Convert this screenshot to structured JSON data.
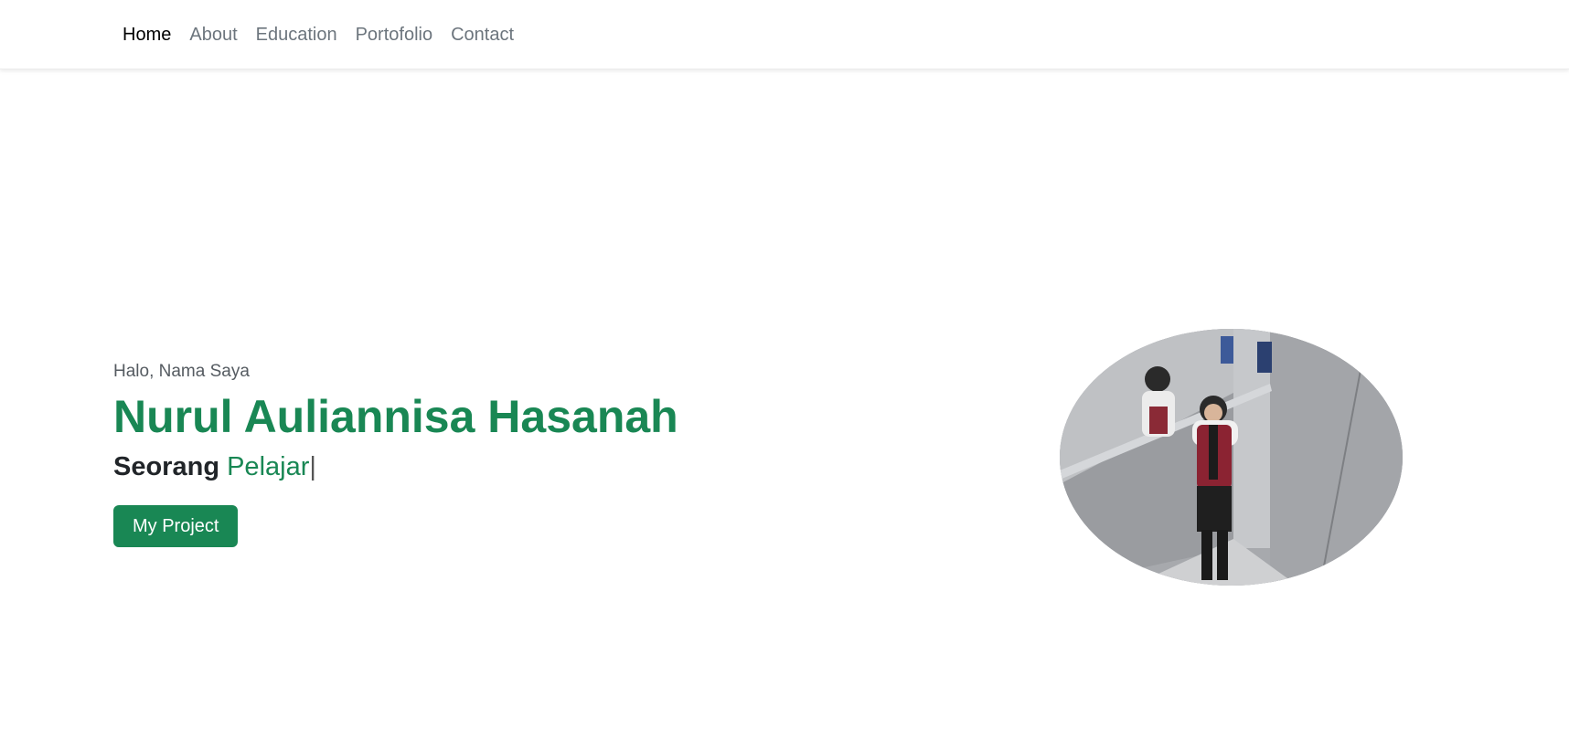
{
  "nav": {
    "items": [
      {
        "label": "Home",
        "active": true
      },
      {
        "label": "About",
        "active": false
      },
      {
        "label": "Education",
        "active": false
      },
      {
        "label": "Portofolio",
        "active": false
      },
      {
        "label": "Contact",
        "active": false
      }
    ]
  },
  "hero": {
    "greeting": "Halo, Nama Saya",
    "name": "Nurul Auliannisa Hasanah",
    "role_prefix": "Seorang",
    "role_highlight": "Pelajar",
    "cursor": "|",
    "button_label": "My Project",
    "photo_alt": "Nurul Auliannisa Hasanah"
  },
  "colors": {
    "accent": "#198754",
    "nav_active": "#000000",
    "nav_inactive": "#6c757d",
    "heading_dark": "#212529"
  }
}
